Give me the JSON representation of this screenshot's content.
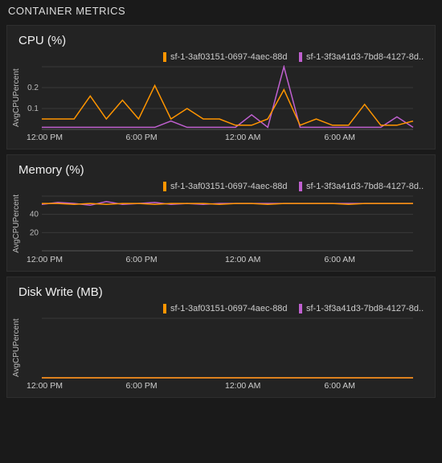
{
  "panel": {
    "title": "CONTAINER METRICS"
  },
  "legend": {
    "series_a": {
      "label": "sf-1-3af03151-0697-4aec-88d...",
      "color": "#ff9500"
    },
    "series_b": {
      "label": "sf-1-3f3a41d3-7bd8-4127-8d...",
      "color": "#c060d0"
    }
  },
  "charts": {
    "cpu": {
      "title": "CPU (%)",
      "ylabel": "AvgCPUPercent",
      "yticks": [
        "0.1",
        "0.2"
      ],
      "xticks": [
        "12:00 PM",
        "6:00 PM",
        "12:00 AM",
        "6:00 AM"
      ]
    },
    "memory": {
      "title": "Memory (%)",
      "ylabel": "AvgCPUPercent",
      "yticks": [
        "20",
        "40"
      ],
      "xticks": [
        "12:00 PM",
        "6:00 PM",
        "12:00 AM",
        "6:00 AM"
      ]
    },
    "disk": {
      "title": "Disk Write (MB)",
      "ylabel": "AvgCPUPercent",
      "yticks": [],
      "xticks": [
        "12:00 PM",
        "6:00 PM",
        "12:00 AM",
        "6:00 AM"
      ]
    }
  },
  "chart_data": [
    {
      "id": "cpu",
      "type": "line",
      "title": "CPU (%)",
      "xlabel": "",
      "ylabel": "AvgCPUPercent",
      "ylim": [
        0,
        0.3
      ],
      "x": [
        0,
        1,
        2,
        3,
        4,
        5,
        6,
        7,
        8,
        9,
        10,
        11,
        12,
        13,
        14,
        15,
        16,
        17,
        18,
        19,
        20,
        21,
        22,
        23
      ],
      "x_tick_labels": [
        "12:00 PM",
        "6:00 PM",
        "12:00 AM",
        "6:00 AM"
      ],
      "series": [
        {
          "name": "sf-1-3af03151-0697-4aec-88d...",
          "color": "#ff9500",
          "values": [
            0.05,
            0.05,
            0.05,
            0.16,
            0.05,
            0.14,
            0.05,
            0.21,
            0.05,
            0.1,
            0.05,
            0.05,
            0.02,
            0.02,
            0.05,
            0.19,
            0.02,
            0.05,
            0.02,
            0.02,
            0.12,
            0.02,
            0.02,
            0.04
          ]
        },
        {
          "name": "sf-1-3f3a41d3-7bd8-4127-8d...",
          "color": "#c060d0",
          "values": [
            0.01,
            0.01,
            0.01,
            0.01,
            0.01,
            0.01,
            0.01,
            0.01,
            0.04,
            0.01,
            0.01,
            0.01,
            0.01,
            0.07,
            0.01,
            0.3,
            0.01,
            0.01,
            0.01,
            0.01,
            0.01,
            0.01,
            0.06,
            0.01
          ]
        }
      ]
    },
    {
      "id": "memory",
      "type": "line",
      "title": "Memory (%)",
      "xlabel": "",
      "ylabel": "AvgCPUPercent",
      "ylim": [
        0,
        60
      ],
      "x": [
        0,
        1,
        2,
        3,
        4,
        5,
        6,
        7,
        8,
        9,
        10,
        11,
        12,
        13,
        14,
        15,
        16,
        17,
        18,
        19,
        20,
        21,
        22,
        23
      ],
      "x_tick_labels": [
        "12:00 PM",
        "6:00 PM",
        "12:00 AM",
        "6:00 AM"
      ],
      "series": [
        {
          "name": "sf-1-3af03151-0697-4aec-88d...",
          "color": "#ff9500",
          "values": [
            52,
            52,
            51,
            52,
            51,
            52,
            52,
            51,
            52,
            52,
            52,
            51,
            52,
            52,
            51,
            52,
            52,
            52,
            52,
            51,
            52,
            52,
            52,
            52
          ]
        },
        {
          "name": "sf-1-3f3a41d3-7bd8-4127-8d...",
          "color": "#c060d0",
          "values": [
            51,
            53,
            52,
            50,
            54,
            51,
            52,
            53,
            51,
            52,
            51,
            52,
            52,
            52,
            52,
            52,
            52,
            52,
            52,
            52,
            52,
            52,
            52,
            52
          ]
        }
      ]
    },
    {
      "id": "disk",
      "type": "line",
      "title": "Disk Write (MB)",
      "xlabel": "",
      "ylabel": "AvgCPUPercent",
      "ylim": [
        0,
        1
      ],
      "x": [
        0,
        1,
        2,
        3,
        4,
        5,
        6,
        7,
        8,
        9,
        10,
        11,
        12,
        13,
        14,
        15,
        16,
        17,
        18,
        19,
        20,
        21,
        22,
        23
      ],
      "x_tick_labels": [
        "12:00 PM",
        "6:00 PM",
        "12:00 AM",
        "6:00 AM"
      ],
      "series": [
        {
          "name": "sf-1-3af03151-0697-4aec-88d...",
          "color": "#ff9500",
          "values": [
            0,
            0,
            0,
            0,
            0,
            0,
            0,
            0,
            0,
            0,
            0,
            0,
            0,
            0,
            0,
            0,
            0,
            0,
            0,
            0,
            0,
            0,
            0,
            0
          ]
        },
        {
          "name": "sf-1-3f3a41d3-7bd8-4127-8d...",
          "color": "#c060d0",
          "values": [
            0,
            0,
            0,
            0,
            0,
            0,
            0,
            0,
            0,
            0,
            0,
            0,
            0,
            0,
            0,
            0,
            0,
            0,
            0,
            0,
            0,
            0,
            0,
            0
          ]
        }
      ]
    }
  ]
}
